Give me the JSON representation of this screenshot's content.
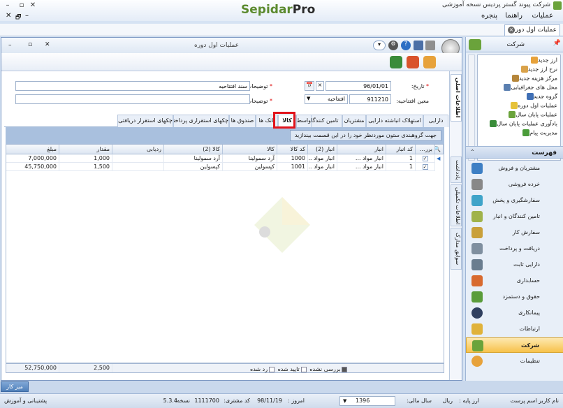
{
  "app": {
    "title": "شرکت پیوند گستر پردیس نسخه آموزشی",
    "logo_main": "Sepidar",
    "logo_pro": "Pro"
  },
  "menubar": {
    "items": [
      "عملیات",
      "راهنما",
      "پنجره"
    ],
    "left_controls": [
      "✕",
      "🗗",
      "–"
    ]
  },
  "doc_tab": {
    "label": "عملیات اول دوره"
  },
  "right_panel": {
    "header": "شرکت",
    "tree": [
      "ارز جدید",
      "نرخ ارز جدید",
      "مرکز هزینه جدید",
      "محل های جغرافیایی",
      "گروه جدید",
      "عملیات اول دوره",
      "عملیات پایان سال",
      "یادآوری عملیات پایان سال",
      "مدیریت پیام"
    ],
    "section": "فهرست",
    "nav": [
      "مشتریان و فروش",
      "خرده فروشی",
      "سفارشگیری و پخش",
      "تامین کنندگان و انبار",
      "سفارش کار",
      "دریافت و پرداخت",
      "دارایی ثابت",
      "حسابداری",
      "حقوق و دستمزد",
      "پیمانکاری",
      "ارتباطات",
      "شرکت",
      "تنظیمات"
    ],
    "active_nav": "شرکت"
  },
  "main_window": {
    "title": "عملیات اول دوره",
    "form": {
      "date_label": "تاریخ:",
      "date_value": "96/01/01",
      "desc_label": "توضیحات:",
      "desc_value": "سند افتتاحیه",
      "opening_label": "معین افتتاحیه:",
      "opening_code": "911210",
      "opening_name": "افتتاحیه",
      "desc2_label": "توضیحات (2):",
      "desc2_value": ""
    },
    "vertical_tabs": [
      "اطلاعات اصلی",
      "یادداشت",
      "اطلاعات تکمیلی",
      "سوابق مدارک"
    ],
    "tabs": [
      "دارایی",
      "استهلاک انباشته دارایی",
      "مشتریان",
      "تامین کنندگان",
      "واسط",
      "کالا",
      "بانک ها",
      "صندوق ها",
      "چکهای استقراری پرداختی",
      "چکهای استقرار دریافتی"
    ],
    "selected_tab": "کالا",
    "group_hint": "جهت گروهبندی ستون موردنظر خود را در این قسمت بیندازید",
    "columns": [
      "برر...",
      "کد انبار",
      "انبار",
      "انبار (2)",
      "کد کالا",
      "کالا",
      "کالا (2)",
      "ردیابی",
      "مقدار",
      "مبلغ"
    ],
    "rows": [
      [
        "✓",
        "1",
        "انبار مواد ...",
        "انبار مواد ...",
        "1000",
        "آرد سمولینا",
        "آرد سمولینا",
        "",
        "1,000",
        "7,000,000"
      ],
      [
        "✓",
        "1",
        "انبار مواد ...",
        "انبار مواد ...",
        "1001",
        "کپسولین",
        "کپسولین",
        "",
        "1,500",
        "45,750,000"
      ]
    ],
    "totals": {
      "quantity": "2,500",
      "amount": "52,750,000"
    },
    "legend": [
      "بررسی نشده",
      "تایید شده",
      "رد شده"
    ]
  },
  "taskbar": {
    "desk_button": "میز کار"
  },
  "statusbar": {
    "user": "نام کاربر اسم پرست",
    "base_currency_label": "ارز پایه :",
    "base_currency": "ریال",
    "fiscal_year_label": "سال مالی:",
    "fiscal_year": "1396",
    "today_label": "امروز :",
    "today": "98/11/19",
    "customer_code_label": "کد مشتری:",
    "customer_code": "1111700",
    "version_label": "نسخه:",
    "version": "5.3.4",
    "support": "پشتیبانی و آموزش"
  },
  "colors": {
    "accent_active": "#f7c24b",
    "highlight_box": "#e2141b",
    "logo_green": "#5b8a2e"
  }
}
